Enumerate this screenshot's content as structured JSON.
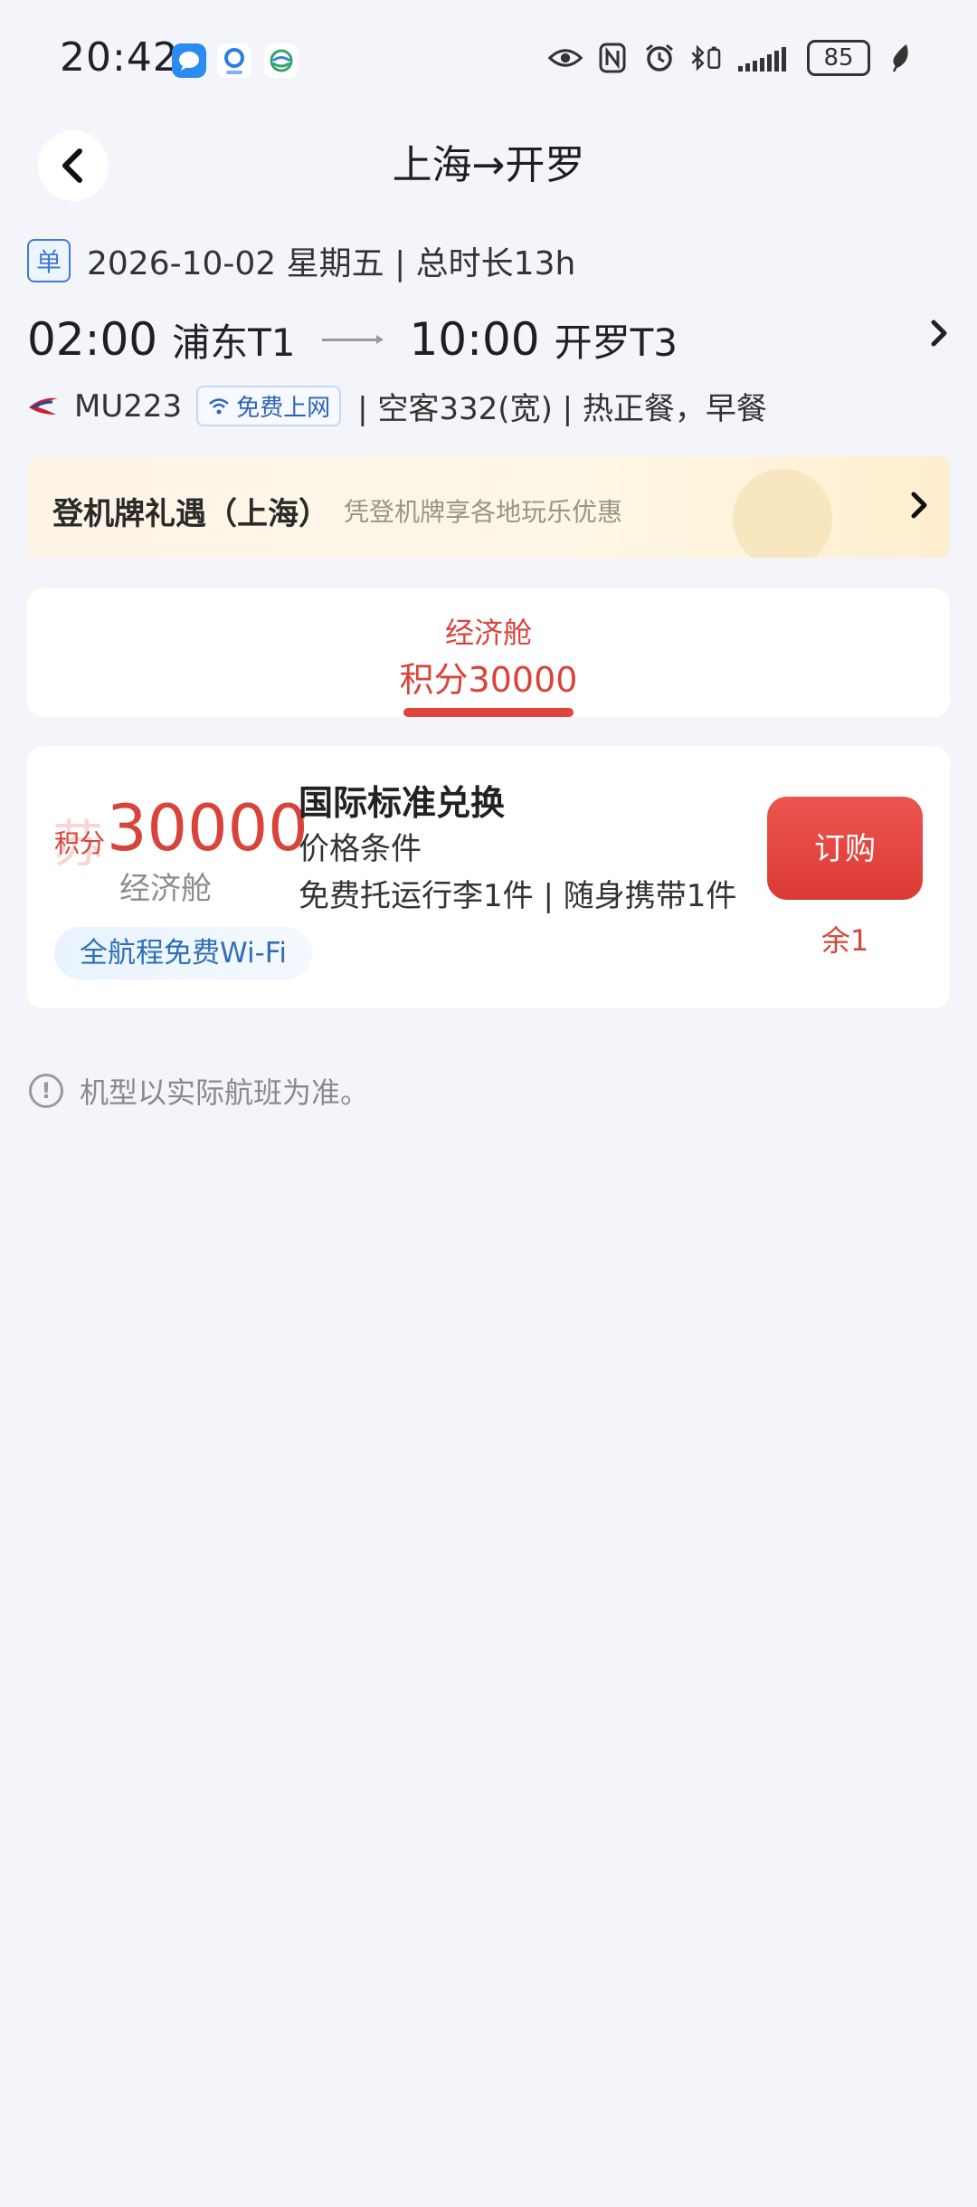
{
  "status_bar": {
    "time": "20:42",
    "battery": "85",
    "icons": [
      "message-app-icon",
      "browser-app-icon",
      "mobile-app-icon",
      "eye-icon",
      "nfc-icon",
      "alarm-icon",
      "bluetooth-icon",
      "signal-icon",
      "battery-icon",
      "leaf-icon"
    ]
  },
  "header": {
    "title": "上海→开罗",
    "back_icon": "chevron-left-icon"
  },
  "trip": {
    "type_tag": "单",
    "date_duration": "2026-10-02 星期五 | 总时长13h"
  },
  "flight": {
    "depart_time": "02:00",
    "depart_airport": "浦东T1",
    "arrive_time": "10:00",
    "arrive_airport": "开罗T3",
    "airline_logo": "china-eastern-logo",
    "flight_no": "MU223",
    "wifi_badge": "免费上网",
    "details": "| 空客332(宽) | 热正餐，早餐"
  },
  "promo": {
    "title": "登机牌礼遇（上海）",
    "subtitle": "凭登机牌享各地玩乐优惠"
  },
  "cabin_tab": {
    "name": "经济舱",
    "points": "积分30000"
  },
  "fare": {
    "watermark": "苏",
    "points_label": "积分",
    "points": "30000",
    "cabin": "经济舱",
    "name": "国际标准兑换",
    "condition": "价格条件",
    "baggage": "免费托运行李1件 | 随身携带1件",
    "wifi": "全航程免费Wi-Fi",
    "book_label": "订购",
    "remaining": "余1"
  },
  "notice": {
    "text": "机型以实际航班为准。"
  },
  "colors": {
    "accent_red": "#d8443c",
    "link_blue": "#3d7bd6",
    "background": "#f3f5fa"
  }
}
